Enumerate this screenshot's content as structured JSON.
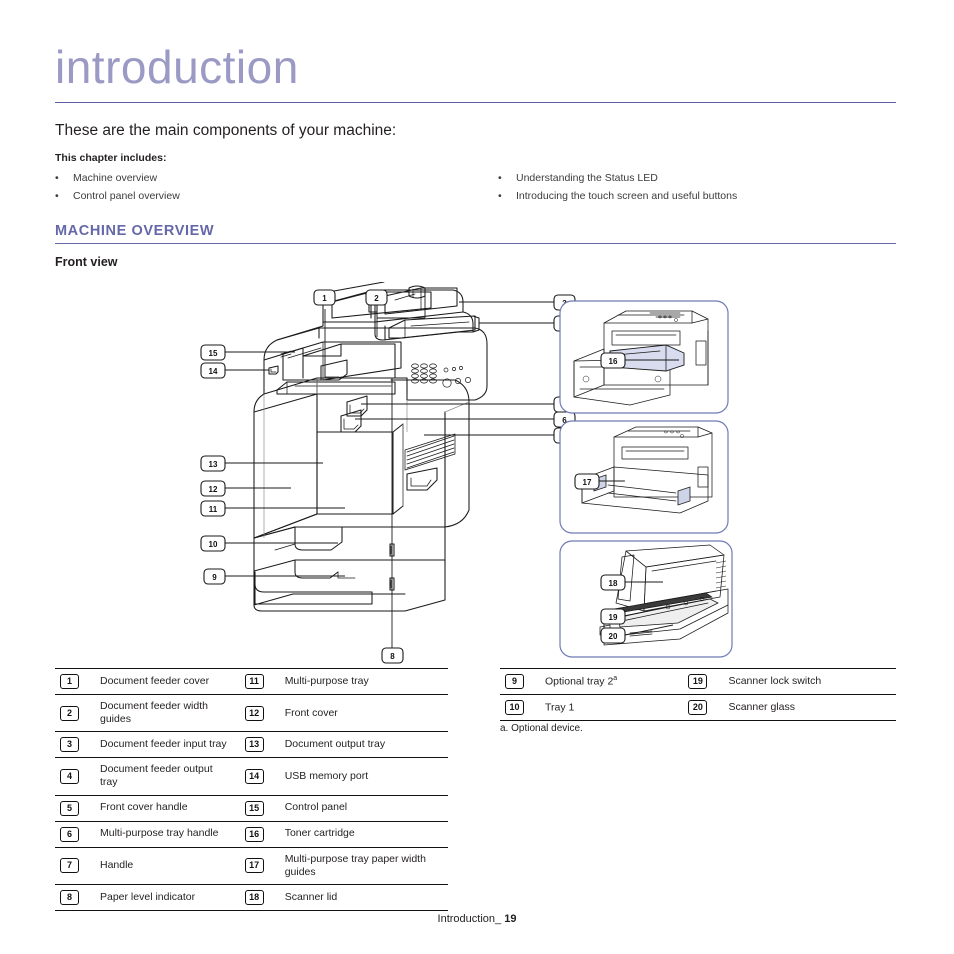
{
  "chapter": {
    "title": "introduction",
    "lede": "These are the main components of your machine:",
    "includes_label": "This chapter includes:",
    "includes_left": [
      "Machine overview",
      "Control panel overview"
    ],
    "includes_right": [
      "Understanding the Status LED",
      "Introducing the touch screen and useful buttons"
    ],
    "bullet_glyph": "•"
  },
  "section": {
    "heading": "MACHINE OVERVIEW",
    "sub_heading": "Front view"
  },
  "figure": {
    "main_caption": "Front view illustration of the multifunction printer with numbered callouts 1 through 15",
    "callouts_main": [
      "1",
      "2",
      "3",
      "4",
      "5",
      "6",
      "7",
      "8",
      "9",
      "10",
      "11",
      "12",
      "13",
      "14",
      "15"
    ],
    "inset_1_callouts": [
      "16"
    ],
    "inset_2_callouts": [
      "17"
    ],
    "inset_3_callouts": [
      "18",
      "19",
      "20"
    ],
    "inset_border_color": "#6e7bb5"
  },
  "legend_left": [
    {
      "n1": "1",
      "l1": "Document feeder cover",
      "n2": "11",
      "l2": "Multi-purpose tray"
    },
    {
      "n1": "2",
      "l1": "Document feeder width guides",
      "n2": "12",
      "l2": "Front cover"
    },
    {
      "n1": "3",
      "l1": "Document feeder input tray",
      "n2": "13",
      "l2": "Document output tray"
    },
    {
      "n1": "4",
      "l1": "Document feeder output tray",
      "n2": "14",
      "l2": "USB memory port"
    },
    {
      "n1": "5",
      "l1": "Front cover handle",
      "n2": "15",
      "l2": "Control panel"
    },
    {
      "n1": "6",
      "l1": "Multi-purpose tray handle",
      "n2": "16",
      "l2": "Toner cartridge"
    },
    {
      "n1": "7",
      "l1": "Handle",
      "n2": "17",
      "l2": "Multi-purpose tray paper width guides"
    },
    {
      "n1": "8",
      "l1": "Paper level indicator",
      "n2": "18",
      "l2": "Scanner lid"
    }
  ],
  "legend_right": [
    {
      "n1": "9",
      "l1": "Optional tray 2",
      "l1_sup": "a",
      "n2": "19",
      "l2": "Scanner lock switch"
    },
    {
      "n1": "10",
      "l1": "Tray 1",
      "l1_sup": "",
      "n2": "20",
      "l2": "Scanner glass"
    }
  ],
  "footnote": "a. Optional device.",
  "footer": {
    "label": "Introduction_",
    "page": "19"
  },
  "colors": {
    "title_purple": "#9a9ac4",
    "rule_purple": "#5b5ea0",
    "heading_purple": "#6568a8",
    "body_text": "#231f20",
    "inset_blue": "#6e7bb5"
  }
}
